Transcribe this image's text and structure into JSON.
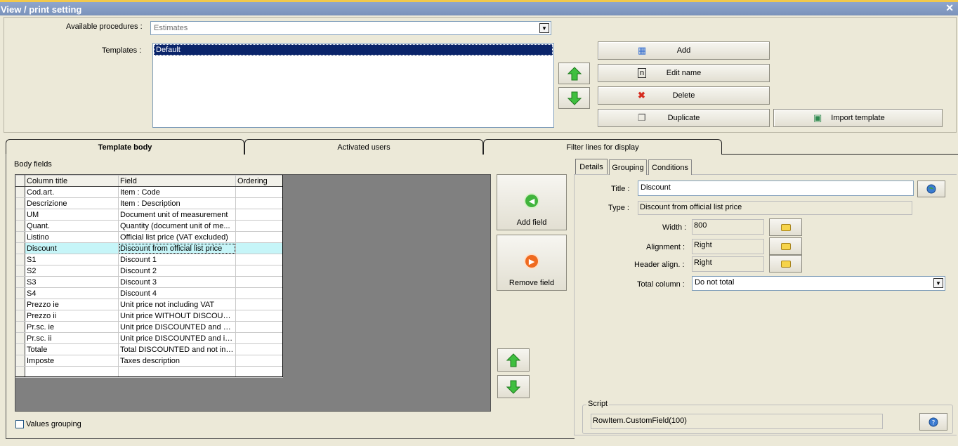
{
  "window": {
    "title": "View / print setting",
    "close_glyph": "✕"
  },
  "top": {
    "procedures_label": "Available procedures :",
    "procedures_value": "Estimates",
    "templates_label": "Templates :",
    "templates": [
      "Default"
    ],
    "buttons": {
      "add": "Add",
      "edit_name": "Edit name",
      "delete": "Delete",
      "duplicate": "Duplicate",
      "import_template": "Import template"
    }
  },
  "tabs": [
    "Template body",
    "Activated users",
    "Filter lines for display"
  ],
  "body": {
    "section_label": "Body fields",
    "columns": [
      "Column title",
      "Field",
      "Ordering"
    ],
    "rows": [
      [
        "Cod.art.",
        "Item : Code",
        ""
      ],
      [
        "Descrizione",
        "Item : Description",
        ""
      ],
      [
        "UM",
        "Document unit of measurement",
        ""
      ],
      [
        "Quant.",
        "Quantity (document unit of me...",
        ""
      ],
      [
        "Listino",
        "Official list price (VAT excluded)",
        ""
      ],
      [
        "Discount",
        "Discount from official list price",
        ""
      ],
      [
        "S1",
        "Discount 1",
        ""
      ],
      [
        "S2",
        "Discount 2",
        ""
      ],
      [
        "S3",
        "Discount 3",
        ""
      ],
      [
        "S4",
        "Discount 4",
        ""
      ],
      [
        "Prezzo ie",
        "Unit price not including VAT",
        ""
      ],
      [
        "Prezzo ii",
        "Unit price WITHOUT DISCOUN...",
        ""
      ],
      [
        "Pr.sc. ie",
        "Unit price DISCOUNTED and no...",
        ""
      ],
      [
        "Pr.sc. ii",
        "Unit price DISCOUNTED and in...",
        ""
      ],
      [
        "Totale",
        "Total DISCOUNTED and not inc...",
        ""
      ],
      [
        "Imposte",
        "Taxes description",
        ""
      ],
      [
        "",
        "",
        ""
      ]
    ],
    "add_field": "Add field",
    "remove_field": "Remove field",
    "values_grouping": "Values grouping"
  },
  "details": {
    "tabs": [
      "Details",
      "Grouping",
      "Conditions"
    ],
    "title_label": "Title :",
    "title_value": "Discount",
    "type_label": "Type :",
    "type_value": "Discount from official list price",
    "width_label": "Width :",
    "width_value": "800",
    "alignment_label": "Alignment :",
    "alignment_value": "Right",
    "header_align_label": "Header align. :",
    "header_align_value": "Right",
    "total_label": "Total column :",
    "total_value": "Do not total",
    "script_label": "Script",
    "script_value": "RowItem.CustomField(100)"
  },
  "colors": {
    "accent_title": "#8fa6cc",
    "selection": "#0a246a",
    "row_highlight": "#c6f5f8"
  }
}
